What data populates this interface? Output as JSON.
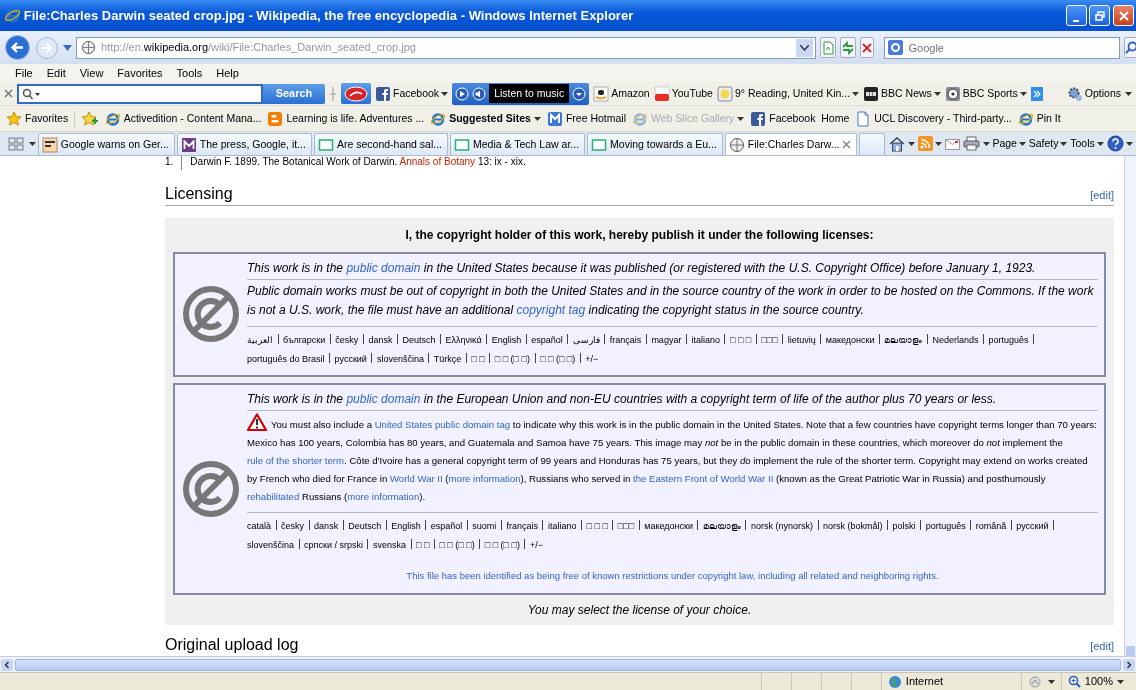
{
  "window": {
    "title": "File:Charles Darwin seated crop.jpg - Wikipedia, the free encyclopedia - Windows Internet Explorer"
  },
  "address_bar": {
    "url": [
      {
        "text": "http://en.",
        "strong": false
      },
      {
        "text": "wikipedia.org",
        "strong": true
      },
      {
        "text": "/wiki/File:Charles_Darwin_seated_crop.jpg",
        "strong": false
      }
    ]
  },
  "search_box": {
    "placeholder": "Google"
  },
  "menu": [
    "File",
    "Edit",
    "View",
    "Favorites",
    "Tools",
    "Help"
  ],
  "toolbar": {
    "search_button": "Search",
    "options": "Options",
    "items": [
      {
        "kind": "facebook",
        "label": "Facebook",
        "dropdown": true
      },
      {
        "kind": "player",
        "label": "Listen to music",
        "dropdown": true
      },
      {
        "kind": "amazon",
        "label": "Amazon",
        "dropdown": false
      },
      {
        "kind": "youtube",
        "label": "YouTube",
        "dropdown": false
      },
      {
        "kind": "weather",
        "label": "9° Reading, United Kin...",
        "dropdown": true
      },
      {
        "kind": "bbc",
        "label": "BBC News",
        "dropdown": true
      },
      {
        "kind": "sports",
        "label": "BBC Sports",
        "dropdown": true
      }
    ]
  },
  "favorites_bar": {
    "label": "Favorites",
    "items": [
      {
        "kind": "ie",
        "label": "Activedition - Content Mana...",
        "bold": false,
        "disabled": false,
        "dropdown": false
      },
      {
        "kind": "blogger",
        "label": "Learning is life. Adventures ...",
        "bold": false,
        "disabled": false,
        "dropdown": false
      },
      {
        "kind": "ie",
        "label": "Suggested Sites",
        "bold": true,
        "disabled": false,
        "dropdown": true
      },
      {
        "kind": "msn",
        "label": "Free Hotmail",
        "bold": false,
        "disabled": false,
        "dropdown": false
      },
      {
        "kind": "ie",
        "label": "Web Slice Gallery",
        "bold": false,
        "disabled": true,
        "dropdown": true
      },
      {
        "kind": "facebook",
        "label": "Facebook  Home",
        "bold": false,
        "disabled": false,
        "dropdown": false
      },
      {
        "kind": "page",
        "label": "UCL Discovery - Third-party...",
        "bold": false,
        "disabled": false,
        "dropdown": false
      },
      {
        "kind": "ie",
        "label": "Pin It",
        "bold": false,
        "disabled": false,
        "dropdown": false
      }
    ]
  },
  "tabs": [
    {
      "kind": "ft",
      "label": "Google warns on Ger...",
      "selected": false
    },
    {
      "kind": "m",
      "label": "The press, Google, it...",
      "selected": false
    },
    {
      "kind": "page",
      "label": "Are second-hand sal...",
      "selected": false
    },
    {
      "kind": "page",
      "label": "Media & Tech Law ar...",
      "selected": false
    },
    {
      "kind": "page",
      "label": "Moving towards a Eu...",
      "selected": false
    },
    {
      "kind": "wiki",
      "label": "File:Charles Darw...",
      "selected": true
    }
  ],
  "command_bar": [
    "Page",
    "Safety",
    "Tools"
  ],
  "page": {
    "reference": {
      "number": "1.",
      "segments": [
        {
          "text": "Darwin F. 1899. The Botanical Work of Darwin. "
        },
        {
          "text": "Annals of Botany",
          "kind": "missing_link"
        },
        {
          "text": " 13: ix - xix."
        }
      ]
    },
    "sections": [
      {
        "heading": "Licensing",
        "edit": "[edit]"
      },
      {
        "heading": "Original upload log",
        "edit": "[edit]"
      }
    ],
    "license_intro": "I, the copyright holder of this work, hereby publish it under the following licenses:",
    "licenses": [
      {
        "paragraphs": [
          {
            "kind": "lead",
            "segments": [
              {
                "text": "This work is in the "
              },
              {
                "text": "**public domain**",
                "kind": "link"
              },
              {
                "text": " in the United States because it was published (or registered with the U.S. Copyright Office) before January 1, 1923."
              }
            ]
          },
          {
            "kind": "lead",
            "segments": [
              {
                "text": "Public domain works must be out of copyright in both the United States and in the source country of the work in order to be hosted on the Commons. If the work is not a U.S. work, the file **must** have an additional "
              },
              {
                "text": "copyright tag",
                "kind": "link"
              },
              {
                "text": " indicating the copyright status in the source country."
              }
            ]
          }
        ],
        "languages": [
          "العربية",
          "български",
          "česky",
          "dansk",
          "Deutsch",
          "Ελληνικά",
          "English",
          "español",
          "فارسی",
          "français",
          "magyar",
          "italiano",
          "□ □ □",
          "□□□",
          "lietuvių",
          "македонски",
          "മലയാളം",
          "Nederlands",
          "português",
          "português do Brasil",
          "русский",
          "slovenščina",
          "Türkçe",
          "□ □",
          "□ □ (□ □)",
          "□ □ (□ □)",
          "+/−"
        ]
      },
      {
        "paragraphs": [
          {
            "kind": "lead",
            "segments": [
              {
                "text": "This work is in the "
              },
              {
                "text": "**public domain**",
                "kind": "link"
              },
              {
                "text": " in the European Union and non-EU countries with a copyright term of life of the author plus **70** years or less."
              }
            ]
          },
          {
            "kind": "warning",
            "segments": [
              {
                "text": "You must also include a "
              },
              {
                "text": "United States public domain tag",
                "kind": "link"
              },
              {
                "text": " to indicate why this work is in the public domain in the United States. Note that a few countries have copyright terms longer than 70 years: Mexico has 100 years, Colombia has 80 years, and Guatemala and Samoa have 75 years. This image may *not* be in the public domain in these countries, which moreover do *not* implement the "
              },
              {
                "text": "rule of the shorter term",
                "kind": "link"
              },
              {
                "text": ". Côte d'Ivoire has a general copyright term of 99 years and Honduras has 75 years, but they *do* implement the rule of the shorter term. Copyright may extend on works created by French who died for France in "
              },
              {
                "text": "World War II",
                "kind": "link"
              },
              {
                "text": " ("
              },
              {
                "text": "more information",
                "kind": "link"
              },
              {
                "text": "), Russians who served in "
              },
              {
                "text": "the Eastern Front of World War II",
                "kind": "link"
              },
              {
                "text": " (known as the Great Patriotic War in Russia) and posthumously "
              },
              {
                "text": "rehabilitated",
                "kind": "link"
              },
              {
                "text": " Russians ("
              },
              {
                "text": "more information",
                "kind": "link"
              },
              {
                "text": ")."
              }
            ]
          }
        ],
        "languages": [
          "català",
          "česky",
          "dansk",
          "Deutsch",
          "English",
          "español",
          "suomi",
          "français",
          "italiano",
          "□ □ □",
          "□□□",
          "македонски",
          "മലയാളം",
          "norsk (nynorsk)",
          "norsk (bokmål)",
          "polski",
          "português",
          "română",
          "русский",
          "slovenščina",
          "српски / srpski",
          "svenska",
          "□ □",
          "□ □ (□ □)",
          "□ □ (□ □)",
          "+/−"
        ],
        "footnote": "This file has been identified as being free of known restrictions under copyright law, including all related and neighboring rights."
      }
    ],
    "choice_note": "You may select the license of your choice."
  },
  "status_bar": {
    "zone": "Internet",
    "zoom": "100%"
  }
}
